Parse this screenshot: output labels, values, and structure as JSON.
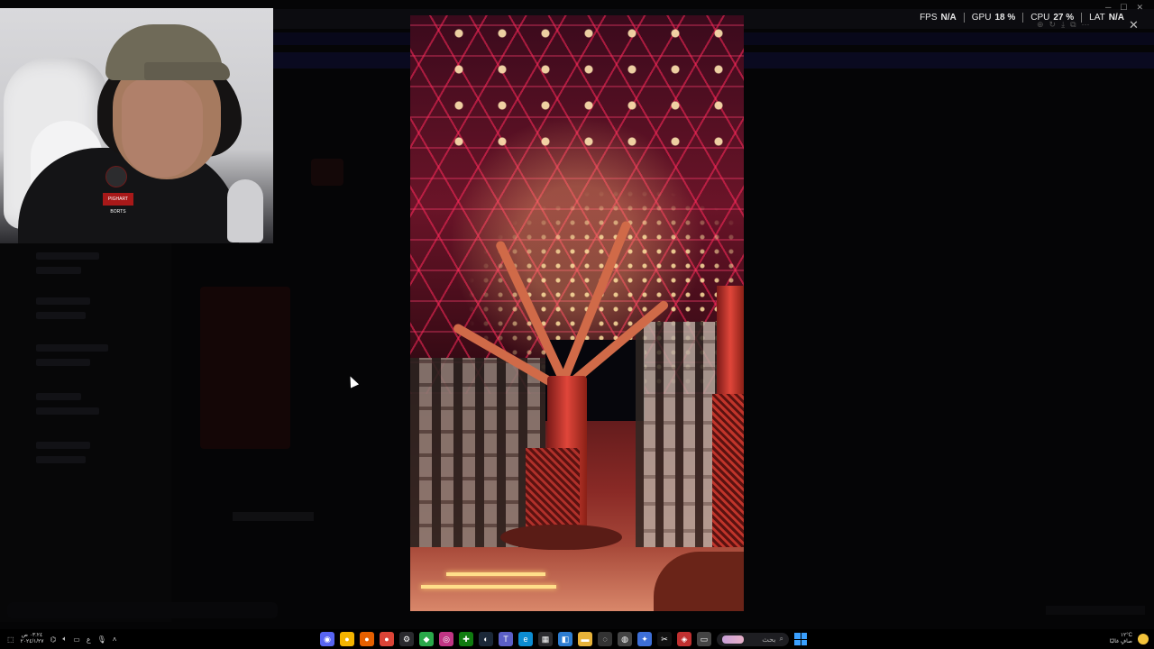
{
  "overlay": {
    "fps_label": "FPS",
    "fps_value": "N/A",
    "gpu_label": "GPU",
    "gpu_value": "18 %",
    "cpu_label": "CPU",
    "cpu_value": "27 %",
    "lat_label": "LAT",
    "lat_value": "N/A"
  },
  "image_viewer": {
    "close_glyph": "✕",
    "tool_icons": [
      "zoom-icon",
      "rotate-icon",
      "download-icon",
      "open-icon",
      "more-icon"
    ]
  },
  "webcam": {
    "patch_text": "PIGHART BORTS"
  },
  "taskbar": {
    "clock_time": "٠٣:٢٤ ص",
    "clock_date": "٢٠٢٤/١/٢٧",
    "lang": "ع",
    "search_label": "بحث",
    "weather_temp": "١٢°C",
    "weather_desc": "صافٍ غالبًا",
    "apps": [
      {
        "name": "discord-icon",
        "glyph": "◉",
        "color": "#5865f2"
      },
      {
        "name": "chrome-canary-icon",
        "glyph": "●",
        "color": "#f4b400"
      },
      {
        "name": "firefox-icon",
        "glyph": "●",
        "color": "#e66000"
      },
      {
        "name": "chrome-icon",
        "glyph": "●",
        "color": "#db4437"
      },
      {
        "name": "system-icon",
        "glyph": "⚙",
        "color": "#2a2a2e"
      },
      {
        "name": "app-green-icon",
        "glyph": "◆",
        "color": "#2aa84a"
      },
      {
        "name": "instagram-icon",
        "glyph": "◎",
        "color": "#c13584"
      },
      {
        "name": "xbox-icon",
        "glyph": "✚",
        "color": "#107c10"
      },
      {
        "name": "steam-icon",
        "glyph": "◐",
        "color": "#1b2838"
      },
      {
        "name": "teams-icon",
        "glyph": "T",
        "color": "#5b5fc7"
      },
      {
        "name": "edge-icon",
        "glyph": "e",
        "color": "#0c8cd2"
      },
      {
        "name": "store-icon",
        "glyph": "▦",
        "color": "#2a2a2e"
      },
      {
        "name": "app-blue-icon",
        "glyph": "◧",
        "color": "#2d7dd2"
      },
      {
        "name": "file-explorer-icon",
        "glyph": "▬",
        "color": "#e8b33a"
      },
      {
        "name": "app-circle-icon",
        "glyph": "◌",
        "color": "#333"
      },
      {
        "name": "obs-icon",
        "glyph": "◍",
        "color": "#444"
      },
      {
        "name": "app-star-icon",
        "glyph": "✦",
        "color": "#3d6fd8"
      },
      {
        "name": "capcut-icon",
        "glyph": "✂",
        "color": "#111"
      },
      {
        "name": "app-red-icon",
        "glyph": "◈",
        "color": "#c03030"
      },
      {
        "name": "app-window-icon",
        "glyph": "▭",
        "color": "#444"
      }
    ]
  }
}
